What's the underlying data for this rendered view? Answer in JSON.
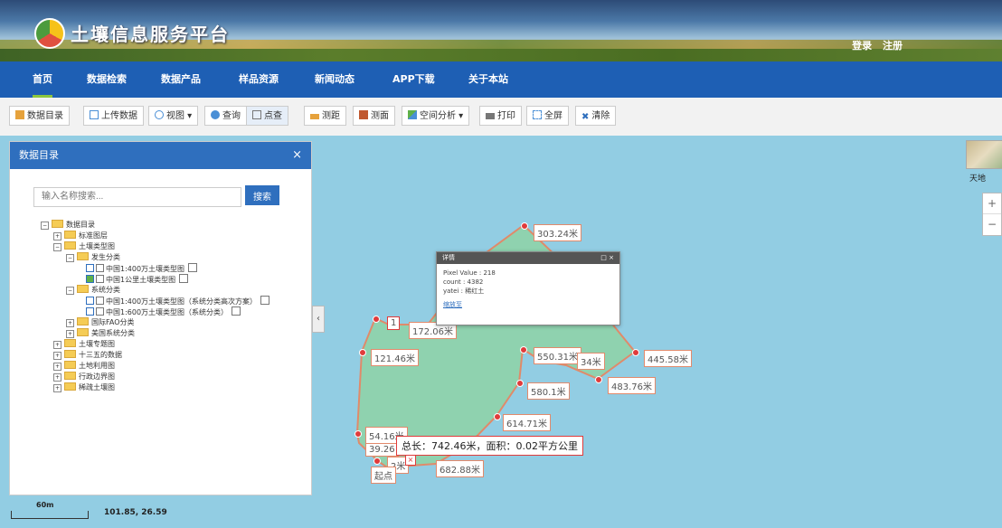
{
  "header": {
    "title": "土壤信息服务平台",
    "login": "登录",
    "register": "注册"
  },
  "nav": {
    "items": [
      "首页",
      "数据检索",
      "数据产品",
      "样品资源",
      "新闻动态",
      "APP下载",
      "关于本站"
    ],
    "active": "首页"
  },
  "toolbar": {
    "catalog": "数据目录",
    "upload": "上传数据",
    "view": "视图",
    "query": "查询",
    "point_query": "点查",
    "measure_distance": "测距",
    "measure_area": "测面",
    "spatial_analysis": "空间分析",
    "print": "打印",
    "fullscreen": "全屏",
    "clear": "清除"
  },
  "catalog_panel": {
    "title": "数据目录",
    "close": "×",
    "search_placeholder": "输入名称搜索...",
    "search_button": "搜索",
    "tree": [
      "数据目录",
      "标准图层",
      "土壤类型图",
      "发生分类",
      "中国1:400万土壤类型图",
      "中国1公里土壤类型图",
      "系统分类",
      "中国1:400万土壤类型图（系统分类高次方案）",
      "中国1:600万土壤类型图（系统分类）",
      "国际FAO分类",
      "美国系统分类",
      "土壤专题图",
      "十三五的数据",
      "土地利用图",
      "行政边界图",
      "稀疏土壤图"
    ]
  },
  "map": {
    "basemap_label": "天地",
    "zoom_in": "+",
    "zoom_out": "−",
    "segment_labels": [
      "303.24米",
      "172.06米",
      "121.46米",
      "550.31米",
      "34米",
      "445.58米",
      "483.76米",
      "580.1米",
      "614.71米",
      "54.16米",
      "39.26",
      "682.88米",
      "2米"
    ],
    "partial_label": "1",
    "start_label": "起点",
    "total": "总长：742.46米，面积：0.02平方公里",
    "close_mark": "×",
    "popup": {
      "title": "详情",
      "pixel_value": "Pixel Value : 218",
      "count": "count : 4382",
      "yatei": "yatei : 稀红土",
      "link": "缩放至"
    }
  },
  "status": {
    "scale": "60m",
    "coords": "101.85, 26.59"
  },
  "colors": {
    "nav_bg": "#1e5fb4",
    "panel_head": "#2f6fbe",
    "map_water": "#92cde3",
    "polygon_fill": "#8fd3a8",
    "polygon_stroke": "#e08a6a"
  }
}
